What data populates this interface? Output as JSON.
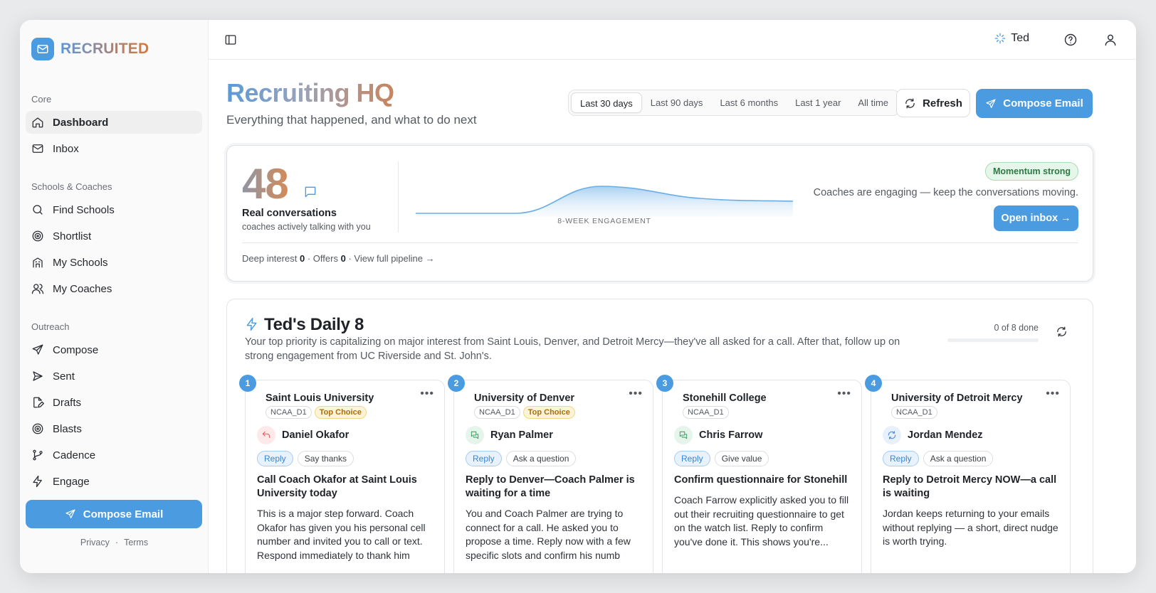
{
  "brand": {
    "name": "RECRUITED"
  },
  "sidebar": {
    "sections": [
      {
        "heading": "Core",
        "items": [
          {
            "label": "Dashboard",
            "icon": "home-icon"
          },
          {
            "label": "Inbox",
            "icon": "mail-icon"
          }
        ]
      },
      {
        "heading": "Schools & Coaches",
        "items": [
          {
            "label": "Find Schools",
            "icon": "search-icon"
          },
          {
            "label": "Shortlist",
            "icon": "target-icon"
          },
          {
            "label": "My Schools",
            "icon": "school-icon"
          },
          {
            "label": "My Coaches",
            "icon": "users-icon"
          }
        ]
      },
      {
        "heading": "Outreach",
        "items": [
          {
            "label": "Compose",
            "icon": "send-icon"
          },
          {
            "label": "Sent",
            "icon": "sent-icon"
          },
          {
            "label": "Drafts",
            "icon": "draft-icon"
          },
          {
            "label": "Blasts",
            "icon": "target-icon"
          },
          {
            "label": "Cadence",
            "icon": "branch-icon"
          },
          {
            "label": "Engage",
            "icon": "bolt-icon"
          }
        ]
      }
    ],
    "compose_label": "Compose Email",
    "footer": {
      "privacy": "Privacy",
      "separator": "·",
      "terms": "Terms"
    }
  },
  "topbar": {
    "user_name": "Ted"
  },
  "header": {
    "title": "Recruiting HQ",
    "subtitle": "Everything that happened, and what to do next",
    "ranges": [
      "Last 30 days",
      "Last 90 days",
      "Last 6 months",
      "Last 1 year",
      "All time"
    ],
    "active_range": "Last 30 days",
    "refresh_label": "Refresh",
    "compose_label": "Compose Email"
  },
  "stats": {
    "count": "48",
    "label": "Real conversations",
    "sublabel": "coaches actively talking with you",
    "chart_caption": "8-WEEK ENGAGEMENT",
    "badge": "Momentum strong",
    "message": "Coaches are engaging — keep the conversations moving.",
    "open_inbox_label": "Open inbox →",
    "deep_interest_label": "Deep interest",
    "deep_interest_value": "0",
    "offers_label": "Offers",
    "offers_value": "0",
    "pipeline_link": "View full pipeline →",
    "separator": "·"
  },
  "daily": {
    "title": "Ted's Daily 8",
    "description": "Your top priority is capitalizing on major interest from Saint Louis, Denver, and Detroit Mercy—they've all asked for a call. After that, follow up on strong engagement from UC Riverside and St. John's.",
    "progress_text": "0 of 8 done",
    "progress_fraction": 0,
    "tasks": [
      {
        "num": "1",
        "school": "Saint Louis University",
        "division": "NCAA_D1",
        "top_choice": "Top Choice",
        "coach": "Daniel Okafor",
        "coach_icon": "reply-arrow-icon",
        "icon_color": "#e35b5b",
        "icon_bg": "#fde9e9",
        "action": "Reply",
        "secondary": "Say thanks",
        "headline": "Call Coach Okafor at Saint Louis University today",
        "body": "This is a major step forward. Coach Okafor has given you his personal cell number and invited you to call or text. Respond immediately to thank him"
      },
      {
        "num": "2",
        "school": "University of Denver",
        "division": "NCAA_D1",
        "top_choice": "Top Choice",
        "coach": "Ryan Palmer",
        "coach_icon": "chat-icon",
        "icon_color": "#3fa366",
        "icon_bg": "#e6f5ec",
        "action": "Reply",
        "secondary": "Ask a question",
        "headline": "Reply to Denver—Coach Palmer is waiting for a time",
        "body": "You and Coach Palmer are trying to connect for a call. He asked you to propose a time. Reply now with a few specific slots and confirm his numb"
      },
      {
        "num": "3",
        "school": "Stonehill College",
        "division": "NCAA_D1",
        "top_choice": "",
        "coach": "Chris Farrow",
        "coach_icon": "chat-icon",
        "icon_color": "#3fa366",
        "icon_bg": "#e6f5ec",
        "action": "Reply",
        "secondary": "Give value",
        "headline": "Confirm questionnaire for Stonehill",
        "body": "Coach Farrow explicitly asked you to fill out their recruiting questionnaire to get on the watch list. Reply to confirm you've done it. This shows you're..."
      },
      {
        "num": "4",
        "school": "University of Detroit Mercy",
        "division": "NCAA_D1",
        "top_choice": "",
        "coach": "Jordan Mendez",
        "coach_icon": "refresh-icon",
        "icon_color": "#4a86d9",
        "icon_bg": "#e8f0fc",
        "action": "Reply",
        "secondary": "Ask a question",
        "headline": "Reply to Detroit Mercy NOW—a call is waiting",
        "body": "Jordan keeps returning to your emails without replying — a short, direct nudge is worth trying."
      }
    ]
  },
  "colors": {
    "accent": "#4a9be0",
    "badge_green": "#2c7a43",
    "top_choice": "#a8700e"
  }
}
